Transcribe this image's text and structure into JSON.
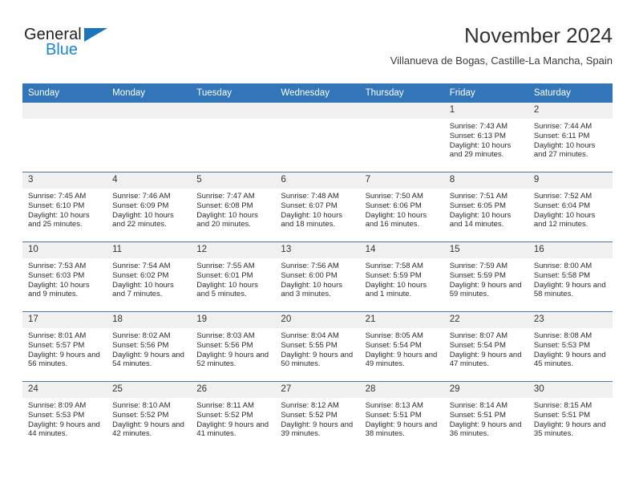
{
  "brand": {
    "name_part1": "General",
    "name_part2": "Blue",
    "triangle_icon": "blue-triangle-logo"
  },
  "header": {
    "title": "November 2024",
    "subtitle": "Villanueva de Bogas, Castille-La Mancha, Spain"
  },
  "colors": {
    "header_blue": "#3275b8",
    "daynum_gray": "#f0f0f0",
    "row_divider": "#4a79a8",
    "brand_blue": "#1b87d4",
    "brand_dark": "#231f20"
  },
  "weekdays": [
    "Sunday",
    "Monday",
    "Tuesday",
    "Wednesday",
    "Thursday",
    "Friday",
    "Saturday"
  ],
  "labels": {
    "sunrise_prefix": "Sunrise:",
    "sunset_prefix": "Sunset:",
    "daylight_prefix": "Daylight:"
  },
  "weeks": [
    [
      {
        "day": "",
        "empty": true
      },
      {
        "day": "",
        "empty": true
      },
      {
        "day": "",
        "empty": true
      },
      {
        "day": "",
        "empty": true
      },
      {
        "day": "",
        "empty": true
      },
      {
        "day": "1",
        "sunrise": "Sunrise: 7:43 AM",
        "sunset": "Sunset: 6:13 PM",
        "daylight": "Daylight: 10 hours and 29 minutes."
      },
      {
        "day": "2",
        "sunrise": "Sunrise: 7:44 AM",
        "sunset": "Sunset: 6:11 PM",
        "daylight": "Daylight: 10 hours and 27 minutes."
      }
    ],
    [
      {
        "day": "3",
        "sunrise": "Sunrise: 7:45 AM",
        "sunset": "Sunset: 6:10 PM",
        "daylight": "Daylight: 10 hours and 25 minutes."
      },
      {
        "day": "4",
        "sunrise": "Sunrise: 7:46 AM",
        "sunset": "Sunset: 6:09 PM",
        "daylight": "Daylight: 10 hours and 22 minutes."
      },
      {
        "day": "5",
        "sunrise": "Sunrise: 7:47 AM",
        "sunset": "Sunset: 6:08 PM",
        "daylight": "Daylight: 10 hours and 20 minutes."
      },
      {
        "day": "6",
        "sunrise": "Sunrise: 7:48 AM",
        "sunset": "Sunset: 6:07 PM",
        "daylight": "Daylight: 10 hours and 18 minutes."
      },
      {
        "day": "7",
        "sunrise": "Sunrise: 7:50 AM",
        "sunset": "Sunset: 6:06 PM",
        "daylight": "Daylight: 10 hours and 16 minutes."
      },
      {
        "day": "8",
        "sunrise": "Sunrise: 7:51 AM",
        "sunset": "Sunset: 6:05 PM",
        "daylight": "Daylight: 10 hours and 14 minutes."
      },
      {
        "day": "9",
        "sunrise": "Sunrise: 7:52 AM",
        "sunset": "Sunset: 6:04 PM",
        "daylight": "Daylight: 10 hours and 12 minutes."
      }
    ],
    [
      {
        "day": "10",
        "sunrise": "Sunrise: 7:53 AM",
        "sunset": "Sunset: 6:03 PM",
        "daylight": "Daylight: 10 hours and 9 minutes."
      },
      {
        "day": "11",
        "sunrise": "Sunrise: 7:54 AM",
        "sunset": "Sunset: 6:02 PM",
        "daylight": "Daylight: 10 hours and 7 minutes."
      },
      {
        "day": "12",
        "sunrise": "Sunrise: 7:55 AM",
        "sunset": "Sunset: 6:01 PM",
        "daylight": "Daylight: 10 hours and 5 minutes."
      },
      {
        "day": "13",
        "sunrise": "Sunrise: 7:56 AM",
        "sunset": "Sunset: 6:00 PM",
        "daylight": "Daylight: 10 hours and 3 minutes."
      },
      {
        "day": "14",
        "sunrise": "Sunrise: 7:58 AM",
        "sunset": "Sunset: 5:59 PM",
        "daylight": "Daylight: 10 hours and 1 minute."
      },
      {
        "day": "15",
        "sunrise": "Sunrise: 7:59 AM",
        "sunset": "Sunset: 5:59 PM",
        "daylight": "Daylight: 9 hours and 59 minutes."
      },
      {
        "day": "16",
        "sunrise": "Sunrise: 8:00 AM",
        "sunset": "Sunset: 5:58 PM",
        "daylight": "Daylight: 9 hours and 58 minutes."
      }
    ],
    [
      {
        "day": "17",
        "sunrise": "Sunrise: 8:01 AM",
        "sunset": "Sunset: 5:57 PM",
        "daylight": "Daylight: 9 hours and 56 minutes."
      },
      {
        "day": "18",
        "sunrise": "Sunrise: 8:02 AM",
        "sunset": "Sunset: 5:56 PM",
        "daylight": "Daylight: 9 hours and 54 minutes."
      },
      {
        "day": "19",
        "sunrise": "Sunrise: 8:03 AM",
        "sunset": "Sunset: 5:56 PM",
        "daylight": "Daylight: 9 hours and 52 minutes."
      },
      {
        "day": "20",
        "sunrise": "Sunrise: 8:04 AM",
        "sunset": "Sunset: 5:55 PM",
        "daylight": "Daylight: 9 hours and 50 minutes."
      },
      {
        "day": "21",
        "sunrise": "Sunrise: 8:05 AM",
        "sunset": "Sunset: 5:54 PM",
        "daylight": "Daylight: 9 hours and 49 minutes."
      },
      {
        "day": "22",
        "sunrise": "Sunrise: 8:07 AM",
        "sunset": "Sunset: 5:54 PM",
        "daylight": "Daylight: 9 hours and 47 minutes."
      },
      {
        "day": "23",
        "sunrise": "Sunrise: 8:08 AM",
        "sunset": "Sunset: 5:53 PM",
        "daylight": "Daylight: 9 hours and 45 minutes."
      }
    ],
    [
      {
        "day": "24",
        "sunrise": "Sunrise: 8:09 AM",
        "sunset": "Sunset: 5:53 PM",
        "daylight": "Daylight: 9 hours and 44 minutes."
      },
      {
        "day": "25",
        "sunrise": "Sunrise: 8:10 AM",
        "sunset": "Sunset: 5:52 PM",
        "daylight": "Daylight: 9 hours and 42 minutes."
      },
      {
        "day": "26",
        "sunrise": "Sunrise: 8:11 AM",
        "sunset": "Sunset: 5:52 PM",
        "daylight": "Daylight: 9 hours and 41 minutes."
      },
      {
        "day": "27",
        "sunrise": "Sunrise: 8:12 AM",
        "sunset": "Sunset: 5:52 PM",
        "daylight": "Daylight: 9 hours and 39 minutes."
      },
      {
        "day": "28",
        "sunrise": "Sunrise: 8:13 AM",
        "sunset": "Sunset: 5:51 PM",
        "daylight": "Daylight: 9 hours and 38 minutes."
      },
      {
        "day": "29",
        "sunrise": "Sunrise: 8:14 AM",
        "sunset": "Sunset: 5:51 PM",
        "daylight": "Daylight: 9 hours and 36 minutes."
      },
      {
        "day": "30",
        "sunrise": "Sunrise: 8:15 AM",
        "sunset": "Sunset: 5:51 PM",
        "daylight": "Daylight: 9 hours and 35 minutes."
      }
    ]
  ]
}
